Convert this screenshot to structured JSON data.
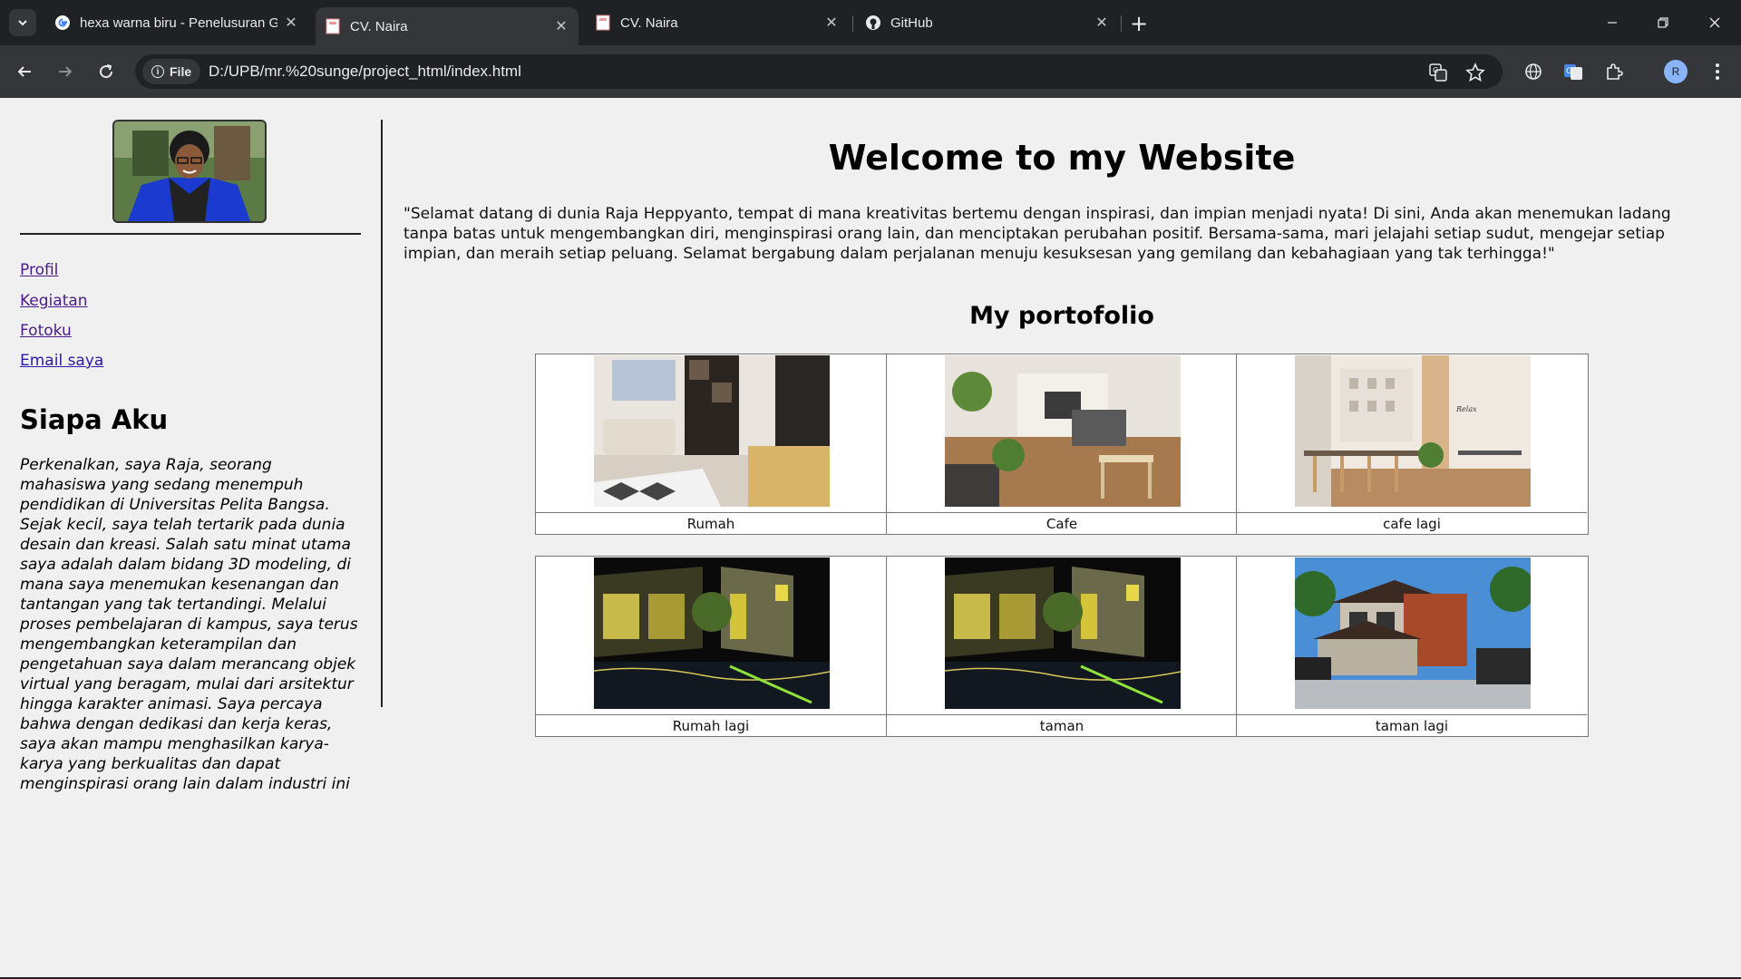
{
  "browser": {
    "tabs": [
      {
        "title": "hexa warna biru - Penelusuran Google",
        "favicon": "google-icon",
        "active": false
      },
      {
        "title": "CV. Naira",
        "favicon": "page-favicon-icon",
        "active": true
      },
      {
        "title": "CV. Naira",
        "favicon": "page-favicon-icon",
        "active": false
      },
      {
        "title": "GitHub",
        "favicon": "github-icon",
        "active": false
      }
    ],
    "omnibox": {
      "chip_label": "File",
      "url": "D:/UPB/mr.%20sunge/project_html/index.html"
    },
    "profile_initial": "R"
  },
  "sidebar": {
    "links": [
      {
        "label": "Profil"
      },
      {
        "label": "Kegiatan"
      },
      {
        "label": "Fotoku"
      },
      {
        "label": "Email saya"
      }
    ],
    "heading": "Siapa Aku",
    "paragraph": "Perkenalkan, saya Raja, seorang mahasiswa yang sedang menempuh pendidikan di Universitas Pelita Bangsa. Sejak kecil, saya telah tertarik pada dunia desain dan kreasi. Salah satu minat utama saya adalah dalam bidang 3D modeling, di mana saya menemukan kesenangan dan tantangan yang tak tertandingi. Melalui proses pembelajaran di kampus, saya terus mengembangkan keterampilan dan pengetahuan saya dalam merancang objek virtual yang beragam, mulai dari arsitektur hingga karakter animasi. Saya percaya bahwa dengan dedikasi dan kerja keras, saya akan mampu menghasilkan karya-karya yang berkualitas dan dapat menginspirasi orang lain dalam industri ini"
  },
  "main": {
    "title": "Welcome to my Website",
    "intro": "\"Selamat datang di dunia Raja Heppyanto, tempat di mana kreativitas bertemu dengan inspirasi, dan impian menjadi nyata! Di sini, Anda akan menemukan ladang tanpa batas untuk mengembangkan diri, menginspirasi orang lain, dan menciptakan perubahan positif. Bersama-sama, mari jelajahi setiap sudut, mengejar setiap impian, dan meraih setiap peluang. Selamat bergabung dalam perjalanan menuju kesuksesan yang gemilang dan kebahagiaan yang tak terhingga!\"",
    "portfolio_title": "My portofolio",
    "portfolio": [
      {
        "caption": "Rumah"
      },
      {
        "caption": "Cafe"
      },
      {
        "caption": "cafe lagi"
      },
      {
        "caption": "Rumah lagi"
      },
      {
        "caption": "taman"
      },
      {
        "caption": "taman lagi"
      }
    ]
  },
  "colors": {
    "link": "#2a1aa8",
    "link_visited": "#4a1a8a",
    "page_bg": "#f0f0f0",
    "chrome_dark": "#202124",
    "chrome_toolbar": "#35363a"
  }
}
